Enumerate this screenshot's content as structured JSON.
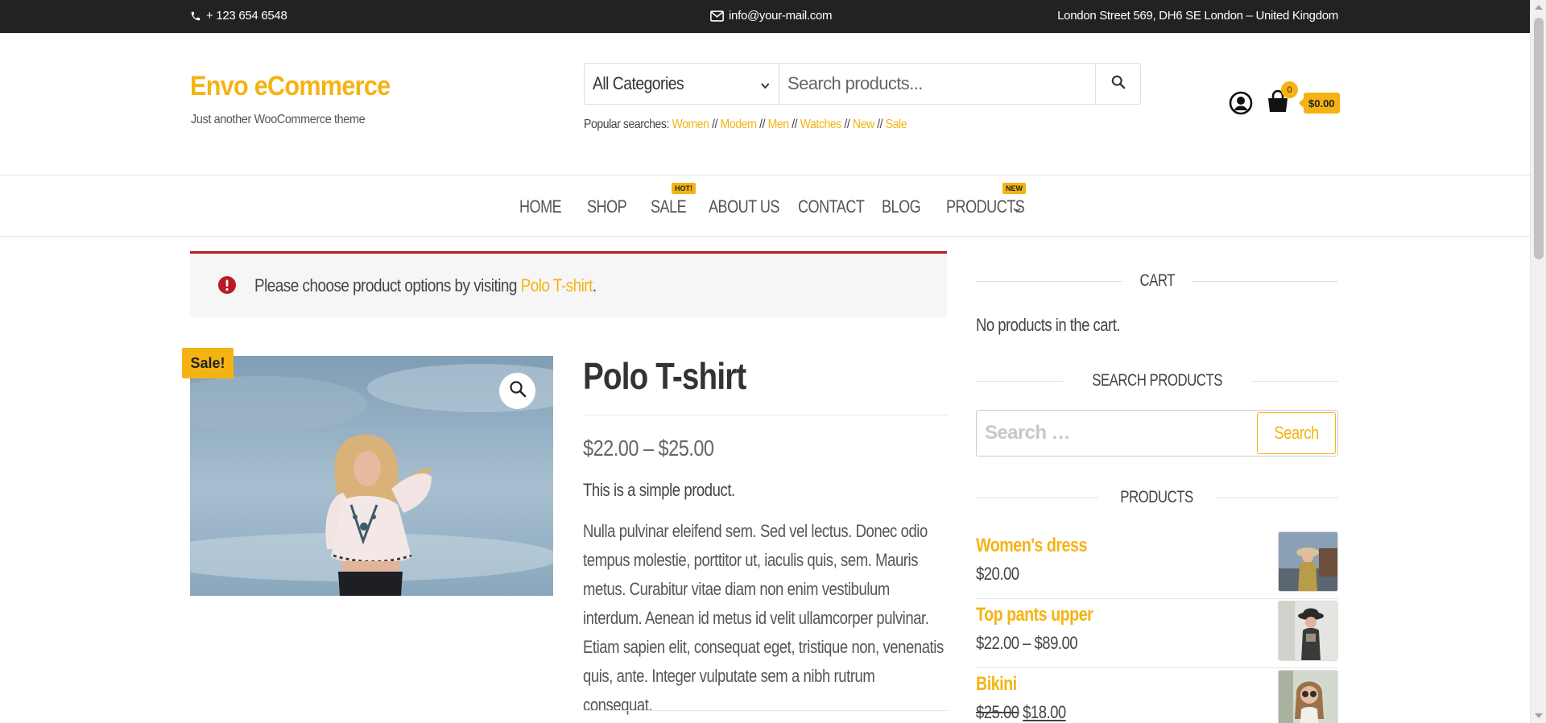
{
  "topbar": {
    "phone": "+ 123 654 6548",
    "email": "info@your-mail.com",
    "address": "London Street 569, DH6 SE London – United Kingdom"
  },
  "header": {
    "site_title": "Envo eCommerce",
    "site_description": "Just another WooCommerce theme",
    "search": {
      "category_selected": "All Categories",
      "placeholder": "Search products..."
    },
    "popular_searches": {
      "label": "Popular searches:",
      "items": [
        "Women",
        "Modern",
        "Men",
        "Watches",
        "New",
        "Sale"
      ]
    },
    "cart": {
      "count": "0",
      "total": "$0.00"
    }
  },
  "nav": {
    "items": [
      {
        "label": "HOME"
      },
      {
        "label": "SHOP"
      },
      {
        "label": "SALE",
        "badge": "HOT!"
      },
      {
        "label": "ABOUT US"
      },
      {
        "label": "CONTACT"
      },
      {
        "label": "BLOG"
      },
      {
        "label": "PRODUCTS",
        "badge": "NEW"
      }
    ]
  },
  "notice": {
    "text": "Please choose product options by visiting ",
    "link": "Polo T-shirt",
    "suffix": "."
  },
  "product": {
    "sale_badge": "Sale!",
    "title": "Polo T-shirt",
    "price": "$22.00 – $25.00",
    "short_description": "This is a simple product.",
    "description": "Nulla pulvinar eleifend sem. Sed vel lectus. Donec odio tempus molestie, porttitor ut, iaculis quis, sem. Mauris metus. Curabitur vitae diam non enim vestibulum interdum. Aenean id metus id velit ullamcorper pulvinar. Etiam sapien elit, consequat eget, tristique non, venenatis quis, ante. Integer vulputate sem a nibh rutrum consequat."
  },
  "sidebar": {
    "cart_title": "CART",
    "cart_empty": "No products in the cart.",
    "search_title": "SEARCH PRODUCTS",
    "search_placeholder": "Search …",
    "search_button": "Search",
    "products_title": "PRODUCTS",
    "products": [
      {
        "name": "Women's dress",
        "price": "$20.00"
      },
      {
        "name": "Top pants upper",
        "price": "$22.00 – $89.00"
      },
      {
        "name": "Bikini",
        "old_price": "$25.00",
        "new_price": "$18.00"
      }
    ]
  },
  "colors": {
    "accent": "#f5b313",
    "topbar_bg": "#222222",
    "notice_border": "#b81c23"
  }
}
